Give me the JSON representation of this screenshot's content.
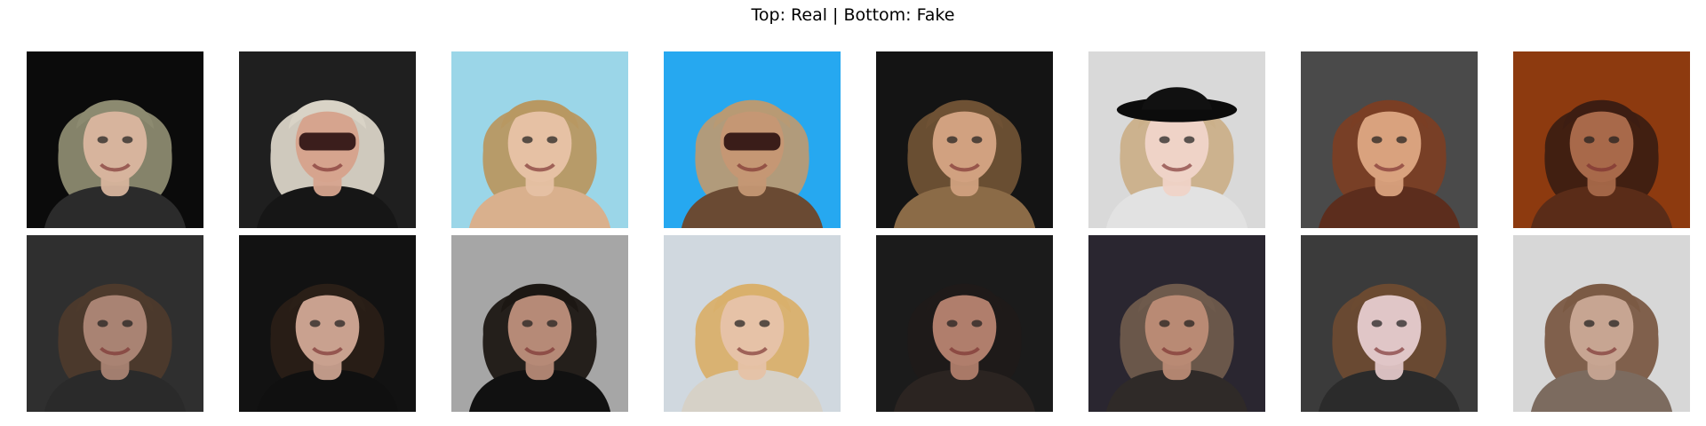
{
  "figure": {
    "title": "Top: Real | Bottom: Fake"
  },
  "rows": [
    {
      "images": [
        {
          "bg": "#0b0b0b",
          "hair": "#8c8a70",
          "skin": "#d7b49d",
          "shirt": "#2b2b2b",
          "glasses": false,
          "hat": false
        },
        {
          "bg": "#1f1f1f",
          "hair": "#d9d3c6",
          "skin": "#d6a48e",
          "shirt": "#161616",
          "glasses": true,
          "hat": false
        },
        {
          "bg": "#9bd6e8",
          "hair": "#b89862",
          "skin": "#e6c1a4",
          "shirt": "#d9b08d",
          "glasses": false,
          "hat": false
        },
        {
          "bg": "#26a8f0",
          "hair": "#b89a74",
          "skin": "#c59774",
          "shirt": "#6a4a33",
          "glasses": true,
          "hat": false
        },
        {
          "bg": "#141414",
          "hair": "#6e5134",
          "skin": "#d1a180",
          "shirt": "#8b6b47",
          "glasses": false,
          "hat": false
        },
        {
          "bg": "#d9d9d9",
          "hair": "#cbb08a",
          "skin": "#efd3c7",
          "shirt": "#e2e2e2",
          "glasses": false,
          "hat": true
        },
        {
          "bg": "#4a4a4a",
          "hair": "#7a3e24",
          "skin": "#d9a27e",
          "shirt": "#5c2d1d",
          "glasses": false,
          "hat": false
        },
        {
          "bg": "#8d3a0f",
          "hair": "#3d1d12",
          "skin": "#a8694a",
          "shirt": "#5a2c18",
          "glasses": false,
          "hat": false
        }
      ]
    },
    {
      "images": [
        {
          "bg": "#2f2f2f",
          "hair": "#4d3a2c",
          "skin": "#a98373",
          "shirt": "#2a2a2a",
          "glasses": false,
          "hat": false
        },
        {
          "bg": "#121212",
          "hair": "#2a1f17",
          "skin": "#c9a18f",
          "shirt": "#101010",
          "glasses": false,
          "hat": false
        },
        {
          "bg": "#a6a6a6",
          "hair": "#1c1713",
          "skin": "#b68a77",
          "shirt": "#111111",
          "glasses": false,
          "hat": false
        },
        {
          "bg": "#d0d8df",
          "hair": "#d9b06c",
          "skin": "#e6c2a7",
          "shirt": "#d6d1c7",
          "glasses": false,
          "hat": false
        },
        {
          "bg": "#1b1b1b",
          "hair": "#1f1a19",
          "skin": "#b07e6c",
          "shirt": "#2b2421",
          "glasses": false,
          "hat": false
        },
        {
          "bg": "#2a2630",
          "hair": "#6e5a4c",
          "skin": "#b98a74",
          "shirt": "#2f2a28",
          "glasses": false,
          "hat": false
        },
        {
          "bg": "#3b3b3b",
          "hair": "#6b4a31",
          "skin": "#e0c6c7",
          "shirt": "#2b2b2b",
          "glasses": false,
          "hat": false
        },
        {
          "bg": "#d7d7d7",
          "hair": "#7b5a44",
          "skin": "#c7a592",
          "shirt": "#7c6b5f",
          "glasses": false,
          "hat": false
        }
      ]
    }
  ]
}
